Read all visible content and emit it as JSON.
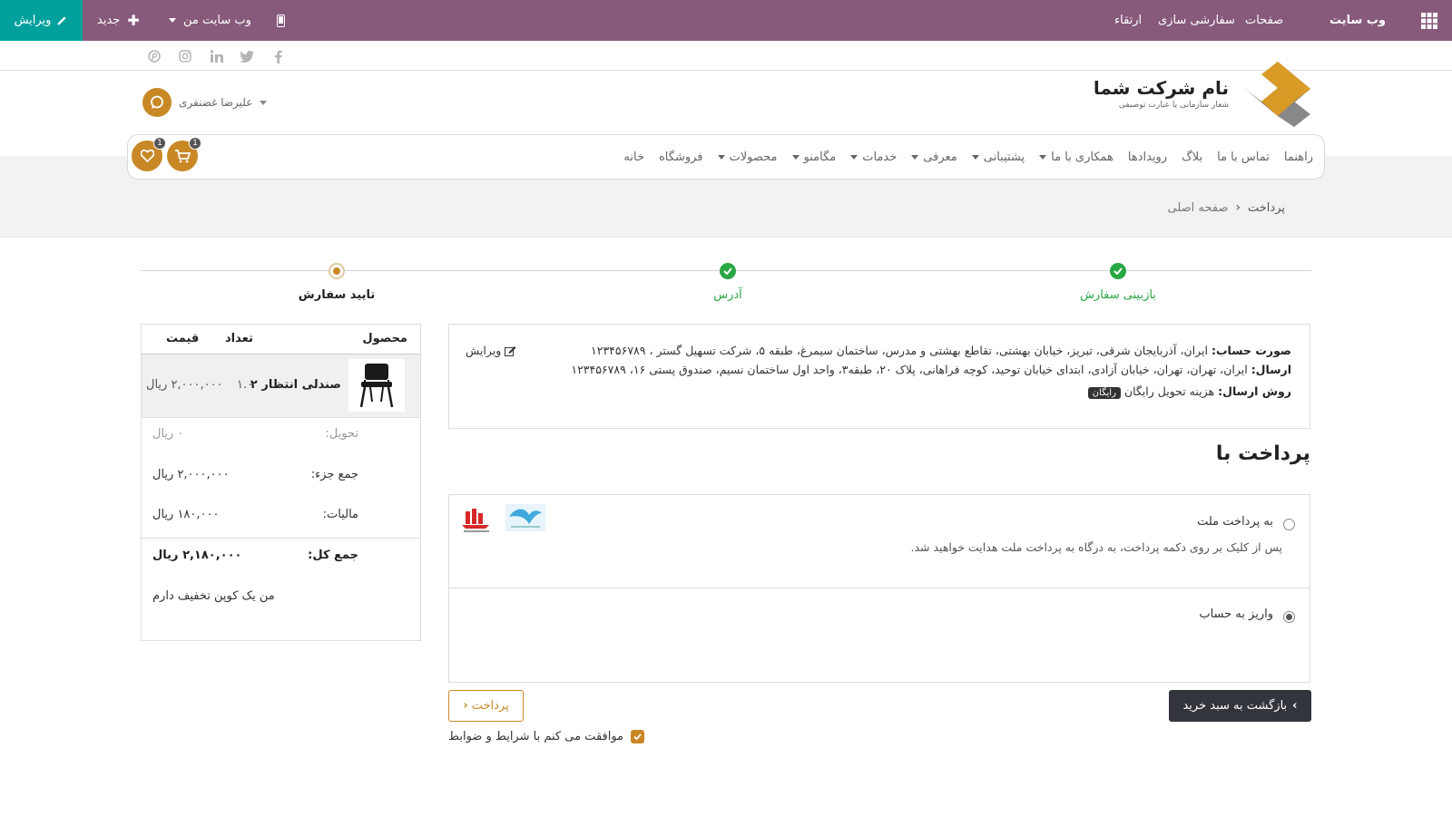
{
  "admin_bar": {
    "site_title": "وب سایت",
    "menu_pages": "صفحات",
    "menu_customize": "سفارشی سازی",
    "menu_upgrade": "ارتقاء",
    "my_website": "وب سایت من",
    "new_label": "جدید",
    "edit_label": "ویرایش"
  },
  "social": [
    "facebook",
    "twitter",
    "linkedin",
    "instagram",
    "pinterest"
  ],
  "header": {
    "company_name": "نام شرکت شما",
    "company_tagline": "شعار سازمانی یا عبارت توصیفی",
    "user_name": "علیرضا غضنفری"
  },
  "nav": {
    "items": [
      {
        "label": "خانه",
        "dropdown": false
      },
      {
        "label": "فروشگاه",
        "dropdown": false
      },
      {
        "label": "محصولات",
        "dropdown": true
      },
      {
        "label": "مگامنو",
        "dropdown": true
      },
      {
        "label": "خدمات",
        "dropdown": true
      },
      {
        "label": "معرفی",
        "dropdown": true
      },
      {
        "label": "پشتیبانی",
        "dropdown": true
      },
      {
        "label": "همکاری با ما",
        "dropdown": true
      },
      {
        "label": "رویدادها",
        "dropdown": false
      },
      {
        "label": "بلاگ",
        "dropdown": false
      },
      {
        "label": "تماس با ما",
        "dropdown": false
      },
      {
        "label": "راهنما",
        "dropdown": false
      }
    ],
    "cart_count": "1",
    "wishlist_count": "1"
  },
  "breadcrumb": {
    "home": "صفحه اصلی",
    "current": "پرداخت"
  },
  "steps": {
    "review": "بازبینی سفارش",
    "address": "آدرس",
    "confirm": "تایید سفارش"
  },
  "summary": {
    "col_product": "محصول",
    "col_qty": "تعداد",
    "col_price": "قیمت",
    "product_name": "صندلی انتظار ۲",
    "product_qty": "۱.۰",
    "product_price": "۲,۰۰۰,۰۰۰ ریال",
    "delivery_label": "تحویل:",
    "delivery_value": "۰ ریال",
    "subtotal_label": "جمع جزء:",
    "subtotal_value": "۲,۰۰۰,۰۰۰ ریال",
    "tax_label": "مالیات:",
    "tax_value": "۱۸۰,۰۰۰ ریال",
    "total_label": "جمع کل:",
    "total_value": "۲,۱۸۰,۰۰۰ ریال",
    "coupon": "من یک کوپن تخفیف دارم"
  },
  "address": {
    "billing_label": "صورت حساب:",
    "billing_text": "ایران، آذربایجان شرقی، تبریز، خیابان بهشتی، تقاطع بهشتی و مدرس، ساختمان سیمرغ، طبقه ۵، شرکت تسهیل گستر ، ۱۲۳۴۵۶۷۸۹",
    "shipping_label": "ارسال:",
    "shipping_text": "ایران، تهران، تهران، خیابان آزادی، ابتدای خیابان توحید، کوچه فراهانی، پلاک ۲۰، طبقه۳، واحد اول ساختمان نسیم، صندوق پستی ۱۶، ۱۲۳۴۵۶۷۸۹",
    "method_label": "روش ارسال:",
    "method_text": "هزینه تحویل رایگان",
    "method_badge": "رایگان",
    "edit_label": "ویرایش"
  },
  "payment": {
    "title": "پرداخت با",
    "option1": "به پرداخت ملت",
    "option1_desc": "پس از کلیک بر روی دکمه پرداخت، به درگاه به پرداخت ملت هدایت خواهید شد.",
    "option2": "واریز به حساب",
    "selected": "option2"
  },
  "buttons": {
    "back": "بازگشت به سبد خرید",
    "pay": "پرداخت",
    "terms": "موافقت می کنم با شرایط و ضوابط"
  },
  "colors": {
    "admin_bar": "#875a7b",
    "edit_button": "#00a09d",
    "accent": "#c98826",
    "success": "#28a745"
  }
}
